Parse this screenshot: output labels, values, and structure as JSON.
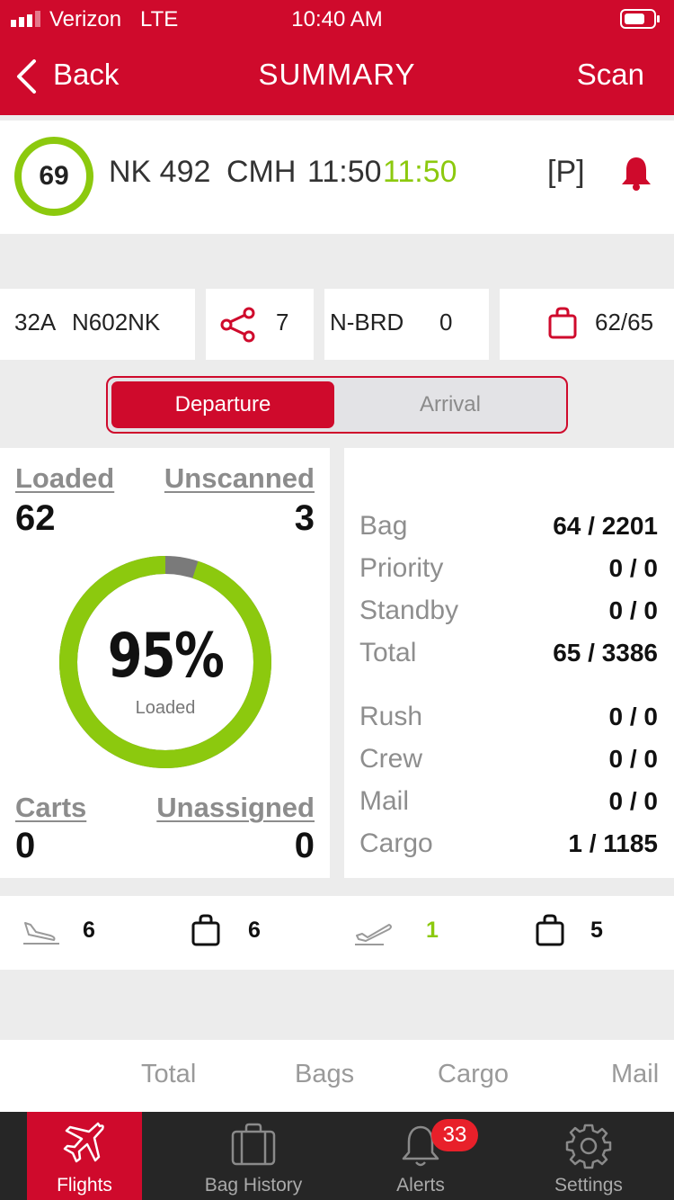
{
  "status_bar": {
    "carrier": "Verizon",
    "network": "LTE",
    "time": "10:40 AM"
  },
  "nav": {
    "back_label": "Back",
    "title": "SUMMARY",
    "scan_label": "Scan"
  },
  "flight": {
    "score": "69",
    "flight_no": "NK 492",
    "station": "CMH",
    "sched_time": "11:50",
    "est_time": "11:50",
    "priority_flag": "[P]"
  },
  "info": {
    "gate": "32A",
    "tail": "N602NK",
    "connections": "7",
    "brd_label": "N-BRD",
    "brd_count": "0",
    "bags_ratio": "62/65"
  },
  "toggle": {
    "departure": "Departure",
    "arrival": "Arrival"
  },
  "summary": {
    "loaded_label": "Loaded",
    "loaded": "62",
    "unscanned_label": "Unscanned",
    "unscanned": "3",
    "percent": "95%",
    "percent_label": "Loaded",
    "percent_value": 95,
    "carts_label": "Carts",
    "carts": "0",
    "unassigned_label": "Unassigned",
    "unassigned": "0"
  },
  "breakdown": [
    {
      "label": "Bag",
      "value": "64 / 2201"
    },
    {
      "label": "Priority",
      "value": "0 / 0"
    },
    {
      "label": "Standby",
      "value": "0 / 0"
    },
    {
      "label": "Total",
      "value": "65 / 3386"
    },
    {
      "label": "Rush",
      "value": "0 / 0"
    },
    {
      "label": "Crew",
      "value": "0 / 0"
    },
    {
      "label": "Mail",
      "value": "0 / 0"
    },
    {
      "label": "Cargo",
      "value": "1 / 1185"
    }
  ],
  "counts": {
    "arrivals": "6",
    "arrival_bags": "6",
    "departures": "1",
    "departure_bags": "5"
  },
  "columns": [
    "Total",
    "Bags",
    "Cargo",
    "Mail"
  ],
  "tabs": {
    "flights": "Flights",
    "bag_history": "Bag History",
    "alerts": "Alerts",
    "alerts_badge": "33",
    "settings": "Settings"
  },
  "colors": {
    "brand_red": "#cf0a2c",
    "accent_green": "#8cc90e",
    "tabbar": "#262626"
  }
}
